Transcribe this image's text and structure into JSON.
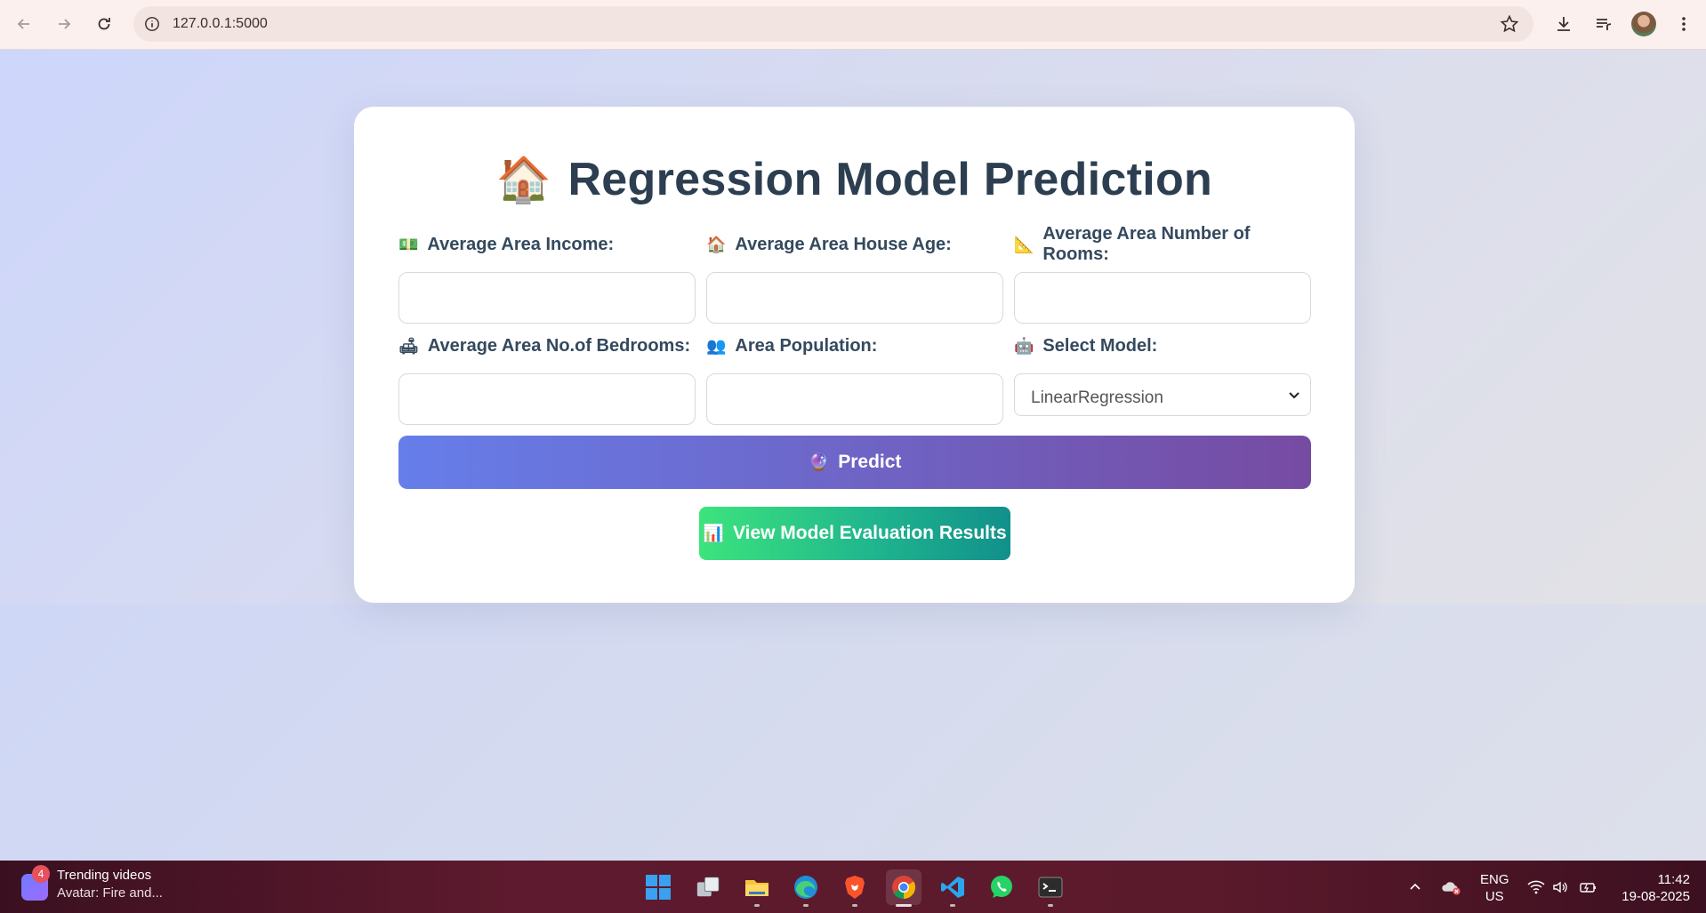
{
  "browser": {
    "url": "127.0.0.1:5000"
  },
  "page": {
    "title_emoji": "🏠",
    "title": "Regression Model Prediction",
    "fields": [
      {
        "emoji": "💵",
        "label": "Average Area Income:",
        "value": ""
      },
      {
        "emoji": "🏠",
        "label": "Average Area House Age:",
        "value": ""
      },
      {
        "emoji": "📐",
        "label": "Average Area Number of Rooms:",
        "value": ""
      },
      {
        "emoji": "🛋",
        "label": "Average Area No.of Bedrooms:",
        "value": ""
      },
      {
        "emoji": "👥",
        "label": "Area Population:",
        "value": ""
      }
    ],
    "model_select": {
      "emoji": "🤖",
      "label": "Select Model:",
      "selected": "LinearRegression"
    },
    "predict_button": {
      "emoji": "🔮",
      "label": "Predict"
    },
    "eval_button": {
      "emoji": "📊",
      "label": "View Model Evaluation Results"
    },
    "colors": {
      "predict_gradient": [
        "#667eea",
        "#764ba2"
      ],
      "eval_gradient": [
        "#3ce47c",
        "#11908b"
      ],
      "title": "#2c3e50"
    }
  },
  "taskbar": {
    "widget_badge": "4",
    "widget_title": "Trending videos",
    "widget_subtitle": "Avatar: Fire and...",
    "apps": [
      "start-icon",
      "task-view-icon",
      "file-explorer-icon",
      "edge-icon",
      "brave-icon",
      "chrome-icon",
      "vscode-icon",
      "whatsapp-icon",
      "terminal-icon"
    ],
    "lang_1": "ENG",
    "lang_2": "US",
    "time": "11:42",
    "date": "19-08-2025"
  }
}
